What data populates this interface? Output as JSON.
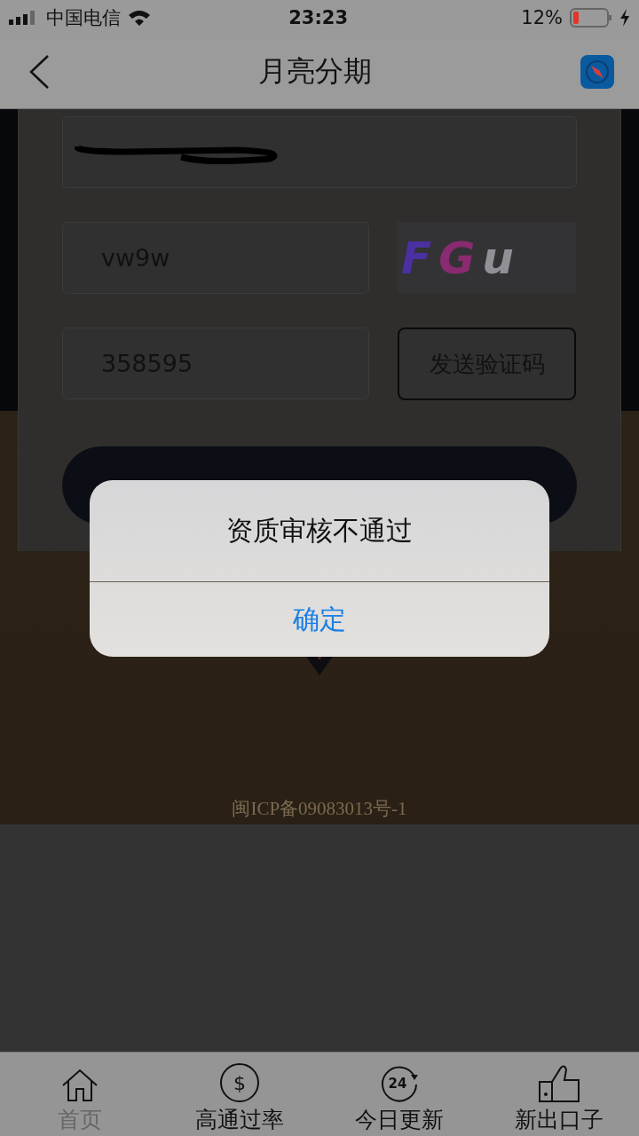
{
  "status_bar": {
    "carrier": "中国电信",
    "time": "23:23",
    "battery": "12%"
  },
  "nav": {
    "title": "月亮分期"
  },
  "form": {
    "captcha_input": {
      "value": "vw9w"
    },
    "captcha_image": {
      "letters": [
        {
          "char": "F",
          "color": "#4a30a0"
        },
        {
          "char": "G",
          "color": "#8a2a70"
        },
        {
          "char": "u",
          "color": "#909096"
        }
      ]
    },
    "sms_input": {
      "value": "358595"
    },
    "send_code_button": "发送验证码"
  },
  "footer": "闽ICP备09083013号-1",
  "dialog": {
    "title": "资质审核不通过",
    "button": "确定"
  },
  "tabs": [
    {
      "label": "首页",
      "selected": true,
      "kind": "home"
    },
    {
      "label": "高通过率",
      "selected": false,
      "kind": "dollar",
      "icon_text": "$"
    },
    {
      "label": "今日更新",
      "selected": false,
      "kind": "refresh",
      "icon_text": "24"
    },
    {
      "label": "新出口子",
      "selected": false,
      "kind": "thumbs"
    }
  ]
}
